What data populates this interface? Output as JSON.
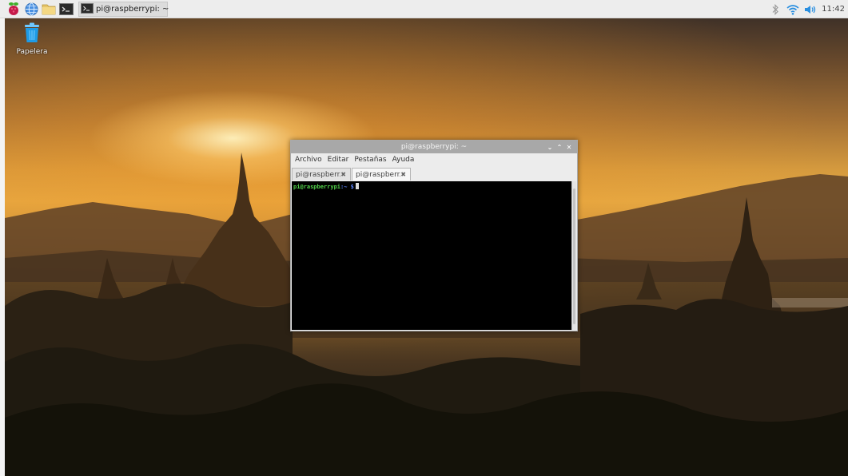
{
  "taskbar": {
    "task": {
      "label": "pi@raspberrypi: ~"
    },
    "clock": "11:42"
  },
  "desktop": {
    "trash": {
      "label": "Papelera"
    }
  },
  "terminal": {
    "title": "pi@raspberrypi: ~",
    "menu": [
      "Archivo",
      "Editar",
      "Pestañas",
      "Ayuda"
    ],
    "tabs": [
      {
        "label": "pi@raspberr...",
        "active": false
      },
      {
        "label": "pi@raspberr...",
        "active": true
      }
    ],
    "prompt": {
      "user": "pi@raspberrypi",
      "path": ":~",
      "symbol": " $"
    }
  },
  "colors": {
    "prompt_user": "#53d34b",
    "prompt_path": "#5f87ff",
    "raspberry": "#c51a4a"
  },
  "icons": {
    "menu": "raspberry-icon",
    "browser": "globe-icon",
    "files": "folder-icon",
    "terminal": "terminal-icon",
    "bluetooth": "bluetooth-icon",
    "wifi": "wifi-icon",
    "volume": "volume-icon",
    "trash": "trash-icon"
  }
}
